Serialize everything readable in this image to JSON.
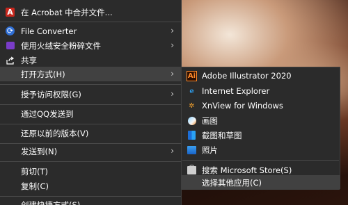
{
  "menu": {
    "items": [
      {
        "label": "在 Acrobat 中合并文件...",
        "icon": "acrobat-icon",
        "submenu": false
      },
      {
        "label": "File Converter",
        "icon": "file-converter-icon",
        "submenu": true
      },
      {
        "label": "使用火绒安全粉碎文件",
        "icon": "huorong-shred-icon",
        "submenu": true
      },
      {
        "label": "共享",
        "icon": "share-icon",
        "submenu": false
      },
      {
        "label": "打开方式(H)",
        "icon": "",
        "submenu": true
      },
      {
        "label": "授予访问权限(G)",
        "icon": "",
        "submenu": true
      },
      {
        "label": "通过QQ发送到",
        "icon": "",
        "submenu": false
      },
      {
        "label": "还原以前的版本(V)",
        "icon": "",
        "submenu": false
      },
      {
        "label": "发送到(N)",
        "icon": "",
        "submenu": true
      },
      {
        "label": "剪切(T)",
        "icon": "",
        "submenu": false
      },
      {
        "label": "复制(C)",
        "icon": "",
        "submenu": false
      },
      {
        "label": "创建快捷方式(S)",
        "icon": "",
        "submenu": false
      }
    ]
  },
  "open_with": {
    "items": [
      {
        "label": "Adobe Illustrator 2020",
        "icon": "illustrator-icon"
      },
      {
        "label": "Internet Explorer",
        "icon": "internet-explorer-icon"
      },
      {
        "label": "XnView for Windows",
        "icon": "xnview-icon"
      },
      {
        "label": "画图",
        "icon": "paint-icon"
      },
      {
        "label": "截图和草图",
        "icon": "snip-sketch-icon"
      },
      {
        "label": "照片",
        "icon": "photos-icon"
      },
      {
        "label": "搜索 Microsoft Store(S)",
        "icon": "microsoft-store-icon"
      },
      {
        "label": "选择其他应用(C)",
        "icon": ""
      }
    ]
  },
  "colors": {
    "menu_bg": "#2b2b2b",
    "highlight": "#414141",
    "separator": "#4a4a4a",
    "text": "#ffffff"
  }
}
